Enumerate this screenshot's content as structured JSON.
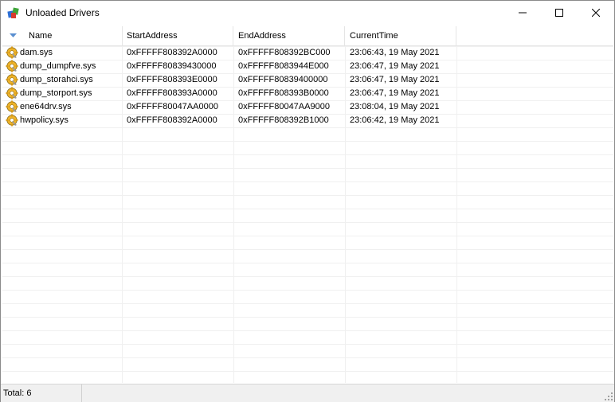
{
  "window": {
    "title": "Unloaded Drivers"
  },
  "columns": [
    "Name",
    "StartAddress",
    "EndAddress",
    "CurrentTime"
  ],
  "rows": [
    {
      "name": "dam.sys",
      "start": "0xFFFFF808392A0000",
      "end": "0xFFFFF808392BC000",
      "time": "23:06:43, 19 May 2021"
    },
    {
      "name": "dump_dumpfve.sys",
      "start": "0xFFFFF80839430000",
      "end": "0xFFFFF8083944E000",
      "time": "23:06:47, 19 May 2021"
    },
    {
      "name": "dump_storahci.sys",
      "start": "0xFFFFF808393E0000",
      "end": "0xFFFFF80839400000",
      "time": "23:06:47, 19 May 2021"
    },
    {
      "name": "dump_storport.sys",
      "start": "0xFFFFF808393A0000",
      "end": "0xFFFFF808393B0000",
      "time": "23:06:47, 19 May 2021"
    },
    {
      "name": "ene64drv.sys",
      "start": "0xFFFFF80047AA0000",
      "end": "0xFFFFF80047AA9000",
      "time": "23:08:04, 19 May 2021"
    },
    {
      "name": "hwpolicy.sys",
      "start": "0xFFFFF808392A0000",
      "end": "0xFFFFF808392B1000",
      "time": "23:06:42, 19 May 2021"
    }
  ],
  "status": {
    "total": "Total: 6"
  },
  "icons": {
    "app": "app-icon",
    "row": "driver-gear-icon",
    "sort": "sort-arrow-icon"
  },
  "colors": {
    "grid": "#f0f0f0",
    "statusbar": "#f0f0f0",
    "sort_arrow": "#5a8fd0"
  }
}
